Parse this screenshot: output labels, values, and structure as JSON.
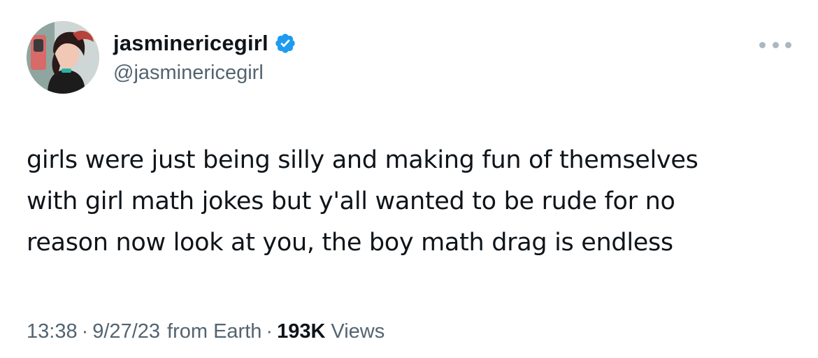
{
  "tweet": {
    "author": {
      "display_name": "jasminericegirl",
      "handle": "@jasminericegirl",
      "verified": true,
      "avatar_icon": "profile-photo"
    },
    "more_icon": "ellipsis-icon",
    "text_lines": [
      "girls were just being silly and making fun of themselves",
      "with girl math jokes but y'all wanted to be rude for no",
      "reason now look at you, the boy math drag is endless"
    ],
    "meta": {
      "time": "13:38",
      "separator": "·",
      "date": "9/27/23",
      "source": "from Earth",
      "views_count": "193K",
      "views_label": "Views"
    }
  },
  "colors": {
    "text_primary": "#0f1419",
    "text_secondary": "#536471",
    "verified_badge": "#1d9bf0",
    "more_dots": "#aab8c2",
    "background": "#ffffff"
  }
}
